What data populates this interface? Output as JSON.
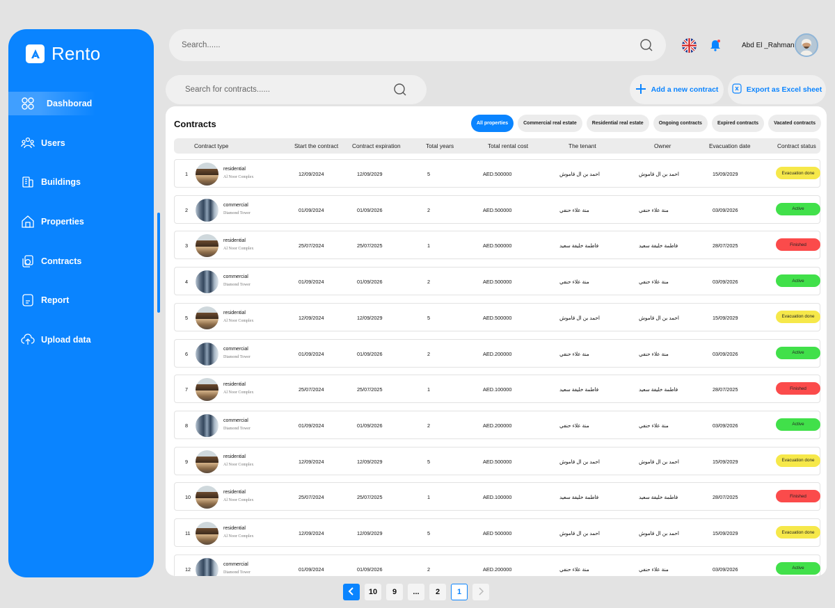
{
  "app": {
    "name": "Rento"
  },
  "sidebar": {
    "items": [
      {
        "label": "Dashborad",
        "icon": "dashboard-icon",
        "active": true
      },
      {
        "label": "Users",
        "icon": "users-icon",
        "active": false
      },
      {
        "label": "Buildings",
        "icon": "building-icon",
        "active": false
      },
      {
        "label": "Properties",
        "icon": "home-icon",
        "active": false
      },
      {
        "label": "Contracts",
        "icon": "contracts-icon",
        "active": false
      },
      {
        "label": "Report",
        "icon": "report-icon",
        "active": false
      },
      {
        "label": "Upload data",
        "icon": "cloud-upload-icon",
        "active": false
      }
    ]
  },
  "header": {
    "search_placeholder": "Search......",
    "user_name": "Abd El _Rahmann"
  },
  "toolbar": {
    "contract_search_placeholder": "Search for contracts......",
    "add_label": "Add a new contract",
    "export_label": "Export as Excel sheet"
  },
  "panel": {
    "title": "Contracts",
    "filters": [
      "All properties",
      "Commercial real estate",
      "Residential real estate",
      "Ongoing contracts",
      "Expired contracts",
      "Vacated contracts"
    ],
    "active_filter": 0,
    "columns": [
      "Contract type",
      "Start the contract",
      "Contract expiration",
      "Total years",
      "Total rental cost",
      "The tenant",
      "Owner",
      "Evacuation date",
      "Contract status"
    ]
  },
  "rows": [
    {
      "n": "1",
      "type": "residential",
      "name": "Al Noor Complex",
      "start": "12/09/2024",
      "end": "12/09/2029",
      "years": "5",
      "cost": "AED.500000",
      "tenant": "احمد بن ال قاموش",
      "owner": "احمد بن ال قاموش",
      "evac": "15/09/2029",
      "status": "Evacuation done",
      "status_color": "#f6e84a"
    },
    {
      "n": "2",
      "type": "commercial",
      "name": "Diamond Tower",
      "start": "01/09/2024",
      "end": "01/09/2026",
      "years": "2",
      "cost": "AED.500000",
      "tenant": "منة علاء حنفي",
      "owner": "منة علاء حنفي",
      "evac": "03/09/2026",
      "status": "Active",
      "status_color": "#41e04a"
    },
    {
      "n": "3",
      "type": "residential",
      "name": "Al Noor Complex",
      "start": "25/07/2024",
      "end": "25/07/2025",
      "years": "1",
      "cost": "AED.500000",
      "tenant": "فاطمة خليفة سعيد",
      "owner": "فاطمة خليفة سعيد",
      "evac": "28/07/2025",
      "status": "Finished",
      "status_color": "#fb4b4b"
    },
    {
      "n": "4",
      "type": "commercial",
      "name": "Diamond Tower",
      "start": "01/09/2024",
      "end": "01/09/2026",
      "years": "2",
      "cost": "AED.500000",
      "tenant": "منة علاء حنفي",
      "owner": "منة علاء حنفي",
      "evac": "03/09/2026",
      "status": "Active",
      "status_color": "#41e04a"
    },
    {
      "n": "5",
      "type": "residential",
      "name": "Al Noor Complex",
      "start": "12/09/2024",
      "end": "12/09/2029",
      "years": "5",
      "cost": "AED.500000",
      "tenant": "احمد بن ال قاموش",
      "owner": "احمد بن ال قاموش",
      "evac": "15/09/2029",
      "status": "Evacuation done",
      "status_color": "#f6e84a"
    },
    {
      "n": "6",
      "type": "commercial",
      "name": "Diamond Tower",
      "start": "01/09/2024",
      "end": "01/09/2026",
      "years": "2",
      "cost": "AED.200000",
      "tenant": "منة علاء حنفي",
      "owner": "منة علاء حنفي",
      "evac": "03/09/2026",
      "status": "Active",
      "status_color": "#41e04a"
    },
    {
      "n": "7",
      "type": "residential",
      "name": "Al Noor Complex",
      "start": "25/07/2024",
      "end": "25/07/2025",
      "years": "1",
      "cost": "AED.100000",
      "tenant": "فاطمة خليفة سعيد",
      "owner": "فاطمة خليفة سعيد",
      "evac": "28/07/2025",
      "status": "Finished",
      "status_color": "#fb4b4b"
    },
    {
      "n": "8",
      "type": "commercial",
      "name": "Diamond Tower",
      "start": "01/09/2024",
      "end": "01/09/2026",
      "years": "2",
      "cost": "AED.200000",
      "tenant": "منة علاء حنفي",
      "owner": "منة علاء حنفي",
      "evac": "03/09/2026",
      "status": "Active",
      "status_color": "#41e04a"
    },
    {
      "n": "9",
      "type": "residential",
      "name": "Al Noor Complex",
      "start": "12/09/2024",
      "end": "12/09/2029",
      "years": "5",
      "cost": "AED.500000",
      "tenant": "احمد بن ال قاموش",
      "owner": "احمد بن ال قاموش",
      "evac": "15/09/2029",
      "status": "Evacuation done",
      "status_color": "#f6e84a"
    },
    {
      "n": "10",
      "type": "residential",
      "name": "Al Noor Complex",
      "start": "25/07/2024",
      "end": "25/07/2025",
      "years": "1",
      "cost": "AED.100000",
      "tenant": "فاطمة خليفة سعيد",
      "owner": "فاطمة خليفة سعيد",
      "evac": "28/07/2025",
      "status": "Finished",
      "status_color": "#fb4b4b"
    },
    {
      "n": "11",
      "type": "residential",
      "name": "Al Noor Complex",
      "start": "12/09/2024",
      "end": "12/09/2029",
      "years": "5",
      "cost": "AED 500000",
      "tenant": "احمد بن ال قاموش",
      "owner": "احمد بن ال قاموش",
      "evac": "15/09/2029",
      "status": "Evacuation done",
      "status_color": "#f6e84a"
    },
    {
      "n": "12",
      "type": "commercial",
      "name": "Diamond Tower",
      "start": "01/09/2024",
      "end": "01/09/2026",
      "years": "2",
      "cost": "AED.200000",
      "tenant": "منة علاء حنفي",
      "owner": "منة علاء حنفي",
      "evac": "03/09/2026",
      "status": "Active",
      "status_color": "#41e04a"
    }
  ],
  "pagination": {
    "pages": [
      "10",
      "9",
      "...",
      "2",
      "1"
    ],
    "current": "1"
  }
}
